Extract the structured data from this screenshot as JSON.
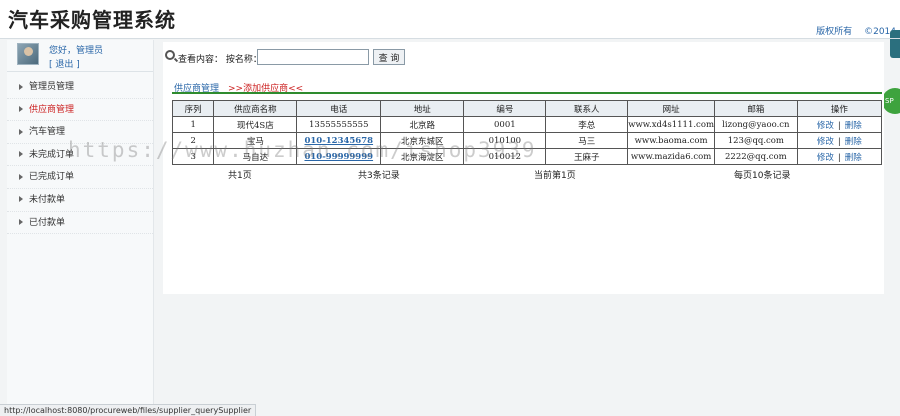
{
  "app": {
    "title": "汽车采购管理系统",
    "copyright": "版权所有",
    "year": "©2014"
  },
  "user": {
    "greeting": "您好，管理员",
    "logout": "[ 退出 ]"
  },
  "sidebar": {
    "items": [
      {
        "label": "管理员管理"
      },
      {
        "label": "供应商管理"
      },
      {
        "label": "汽车管理"
      },
      {
        "label": "未完成订单"
      },
      {
        "label": "已完成订单"
      },
      {
        "label": "未付款单"
      },
      {
        "label": "已付款单"
      }
    ]
  },
  "search": {
    "label": "查看内容： 按名称：",
    "value": "",
    "button": "查 询"
  },
  "section": {
    "title": "供应商管理",
    "add_link": ">>添加供应商<<"
  },
  "table": {
    "headers": [
      "序列",
      "供应商名称",
      "电话",
      "地址",
      "编号",
      "联系人",
      "网址",
      "邮箱",
      "操作"
    ],
    "rows": [
      {
        "seq": "1",
        "name": "现代4S店",
        "phone": "13555555555",
        "address": "北京路",
        "code": "0001",
        "contact": "李总",
        "website": "www.xd4s1111.com",
        "email": "lizong@yaoo.cn",
        "edit": "修改",
        "delete": "删除"
      },
      {
        "seq": "2",
        "name": "宝马",
        "phone": "010-12345678",
        "address": "北京东城区",
        "code": "010100",
        "contact": "马三",
        "website": "www.baoma.com",
        "email": "123@qq.com",
        "edit": "修改",
        "delete": "删除"
      },
      {
        "seq": "3",
        "name": "马自达",
        "phone": "010-99999999",
        "address": "北京海淀区",
        "code": "010012",
        "contact": "王麻子",
        "website": "www.mazida6.com",
        "email": "2222@qq.com",
        "edit": "修改",
        "delete": "删除"
      }
    ],
    "op_separator": "|"
  },
  "pager": {
    "total_pages": "共1页",
    "total_records": "共3条记录",
    "current_page": "当前第1页",
    "per_page": "每页10条记录"
  },
  "watermark": "https://www.huzhan.com/ishop3939",
  "statusbar": {
    "url": "http://localhost:8080/procureweb/files/supplier_querySupplier"
  },
  "badge": "SP"
}
